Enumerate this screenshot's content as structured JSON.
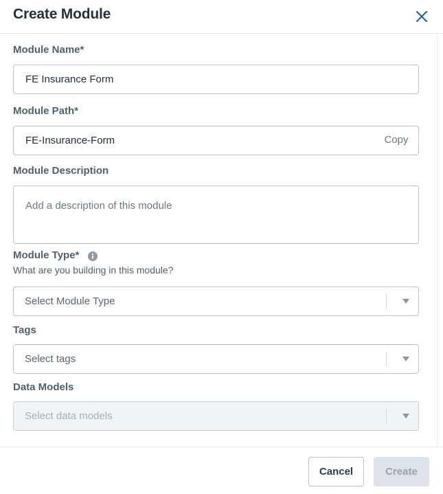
{
  "dialog": {
    "title": "Create Module",
    "close_icon": "close-icon"
  },
  "form": {
    "module_name": {
      "label": "Module Name*",
      "value": "FE Insurance Form"
    },
    "module_path": {
      "label": "Module Path*",
      "value": "FE-Insurance-Form",
      "copy_label": "Copy"
    },
    "module_description": {
      "label": "Module Description",
      "placeholder": "Add a description of this module",
      "value": ""
    },
    "module_type": {
      "label": "Module Type*",
      "info_icon": "info-icon",
      "hint": "What are you building in this module?",
      "placeholder": "Select Module Type",
      "caret_icon": "caret-down-icon"
    },
    "tags": {
      "label": "Tags",
      "placeholder": "Select tags",
      "caret_icon": "caret-down-icon"
    },
    "data_models": {
      "label": "Data Models",
      "placeholder": "Select data models",
      "disabled": true,
      "caret_icon": "caret-down-icon"
    }
  },
  "footer": {
    "cancel_label": "Cancel",
    "create_label": "Create",
    "create_disabled": true
  },
  "colors": {
    "accent": "#1f6f8b",
    "label_text": "#52606d",
    "border": "#b6c1cc",
    "disabled_bg": "#dde3e8"
  }
}
